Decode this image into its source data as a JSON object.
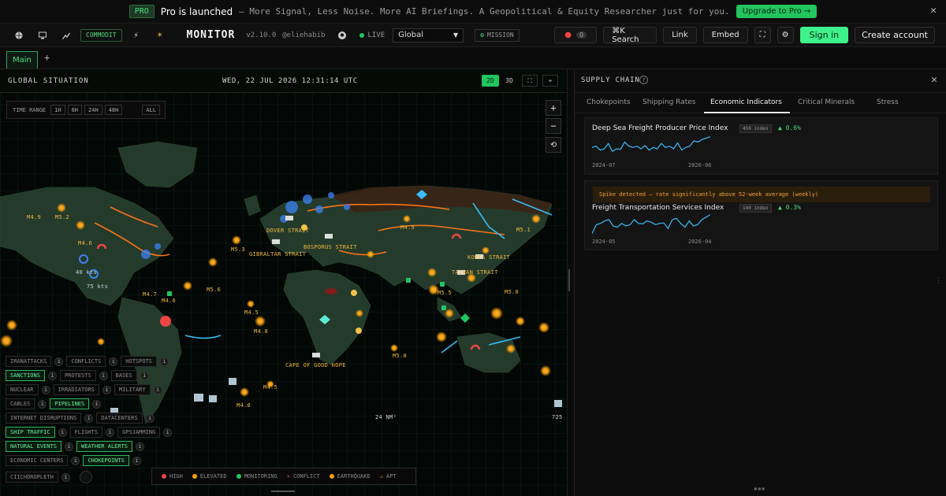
{
  "promo": {
    "badge": "PRO",
    "title": "Pro is launched",
    "description": "– More Signal, Less Noise. More AI Briefings. A Geopolitical & Equity Researcher just for you.",
    "cta": "Upgrade to Pro →",
    "close": "✕"
  },
  "topbar": {
    "commodity_label": "COMMODIT",
    "brand": "MONITOR",
    "version": "v2.10.0",
    "author": "@eliehabib",
    "live": "LIVE",
    "region": "Global",
    "mission": "MISSION",
    "notif_count": "0",
    "search": "⌘K Search",
    "link": "Link",
    "embed": "Embed",
    "signin": "Sign in",
    "create_account": "Create account"
  },
  "tabs": {
    "main": "Main",
    "add": "+"
  },
  "map": {
    "title": "GLOBAL SITUATION",
    "datetime": "WED, 22 JUL 2026 12:31:14 UTC",
    "view_2d": "2D",
    "view_3d": "3D",
    "time_range_label": "TIME RANGE",
    "time_ranges": [
      "1H",
      "6H",
      "24H",
      "48H",
      "ALL"
    ],
    "zoom_in": "+",
    "zoom_out": "−",
    "reset": "⟲",
    "labels": [
      {
        "text": "DOVER STRAIT"
      },
      {
        "text": "GIBRALTAR STRAIT"
      },
      {
        "text": "BOSPORUS STRAIT"
      },
      {
        "text": "KOREA STRAIT"
      },
      {
        "text": "TAIWAN STRAIT"
      },
      {
        "text": "CAPE OF GOOD HOPE"
      },
      {
        "text": "M4.9"
      },
      {
        "text": "M5.2"
      },
      {
        "text": "M4.6"
      },
      {
        "text": "M5.3"
      },
      {
        "text": "M4.5"
      },
      {
        "text": "M5.6"
      },
      {
        "text": "M5.0"
      },
      {
        "text": "M4.8"
      },
      {
        "text": "M5.1"
      },
      {
        "text": "M4.6"
      },
      {
        "text": "M4.5"
      },
      {
        "text": "M5.5"
      },
      {
        "text": "M4.8"
      },
      {
        "text": "M5.0"
      },
      {
        "text": "M4.5"
      },
      {
        "text": "M4.7"
      },
      {
        "text": "40 kts"
      },
      {
        "text": "75 kts"
      },
      {
        "text": "24 NM²"
      },
      {
        "text": "725"
      }
    ],
    "layers": {
      "row1": [
        {
          "label": "IRANATTACKS",
          "on": false
        },
        {
          "label": "CONFLICTS",
          "on": false
        },
        {
          "label": "HOTSPOTS",
          "on": false
        }
      ],
      "row2": [
        {
          "label": "SANCTIONS",
          "on": true
        },
        {
          "label": "PROTESTS",
          "on": false
        },
        {
          "label": "BASES",
          "on": false
        }
      ],
      "row3": [
        {
          "label": "NUCLEAR",
          "on": false
        },
        {
          "label": "IRRADIATORS",
          "on": false
        },
        {
          "label": "MILITARY",
          "on": false
        }
      ],
      "row4": [
        {
          "label": "CABLES",
          "on": false
        },
        {
          "label": "PIPELINES",
          "on": true
        }
      ],
      "row5": [
        {
          "label": "INTERNET DISRUPTIONS",
          "on": false
        },
        {
          "label": "DATACENTERS",
          "on": false
        }
      ],
      "row6": [
        {
          "label": "SHIP TRAFFIC",
          "on": true
        },
        {
          "label": "FLIGHTS",
          "on": false
        },
        {
          "label": "GPSJAMMING",
          "on": false
        }
      ],
      "row7": [
        {
          "label": "NATURAL EVENTS",
          "on": true
        },
        {
          "label": "WEATHER ALERTS",
          "on": true
        }
      ],
      "row8": [
        {
          "label": "ECONOMIC CENTERS",
          "on": false
        },
        {
          "label": "CHOKEPOINTS",
          "on": true
        }
      ],
      "row9": [
        {
          "label": "CIICHOROPLETH",
          "on": false
        }
      ]
    },
    "legend": [
      {
        "label": "HIGH",
        "color": "#ef4444",
        "marker": "dot"
      },
      {
        "label": "ELEVATED",
        "color": "#f59e0b",
        "marker": "dot"
      },
      {
        "label": "MONITORING",
        "color": "#22c55e",
        "marker": "dot"
      },
      {
        "label": "CONFLICT",
        "color": "#ef4444",
        "marker": "✕"
      },
      {
        "label": "EARTHQUAKE",
        "color": "#f59e0b",
        "marker": "dot"
      },
      {
        "label": "APT",
        "color": "#f59e0b",
        "marker": "⚠"
      }
    ]
  },
  "supply_chain": {
    "title": "SUPPLY CHAIN",
    "help": "?",
    "close": "✕",
    "tabs": [
      "Chokepoints",
      "Shipping Rates",
      "Economic Indicators",
      "Critical Minerals",
      "Stress"
    ],
    "active_tab": "Economic Indicators",
    "indicators": [
      {
        "name": "Deep Sea Freight Producer Price Index",
        "index": "459 index",
        "change": "▲ 0.6%",
        "start": "2024-07",
        "end": "2026-06",
        "spike": "",
        "series": [
          0.55,
          0.6,
          0.45,
          0.5,
          0.7,
          0.4,
          0.5,
          0.48,
          0.75,
          0.6,
          0.55,
          0.6,
          0.5,
          0.62,
          0.45,
          0.55,
          0.5,
          0.7,
          0.55,
          0.6,
          0.5,
          0.72,
          0.45,
          0.55,
          0.6,
          0.8,
          0.75,
          0.85,
          0.9,
          0.95
        ]
      },
      {
        "name": "Freight Transportation Services Index",
        "index": "140 index",
        "change": "▲ 0.3%",
        "start": "2024-05",
        "end": "2026-04",
        "spike": "Spike detected — rate significantly above 52-week average (weekly)",
        "series": [
          0.2,
          0.55,
          0.6,
          0.7,
          0.75,
          0.5,
          0.45,
          0.6,
          0.5,
          0.55,
          0.75,
          0.6,
          0.58,
          0.7,
          0.65,
          0.55,
          0.6,
          0.62,
          0.4,
          0.75,
          0.8,
          0.6,
          0.45,
          0.7,
          0.5,
          0.55,
          0.75,
          0.85,
          0.95
        ]
      }
    ]
  }
}
